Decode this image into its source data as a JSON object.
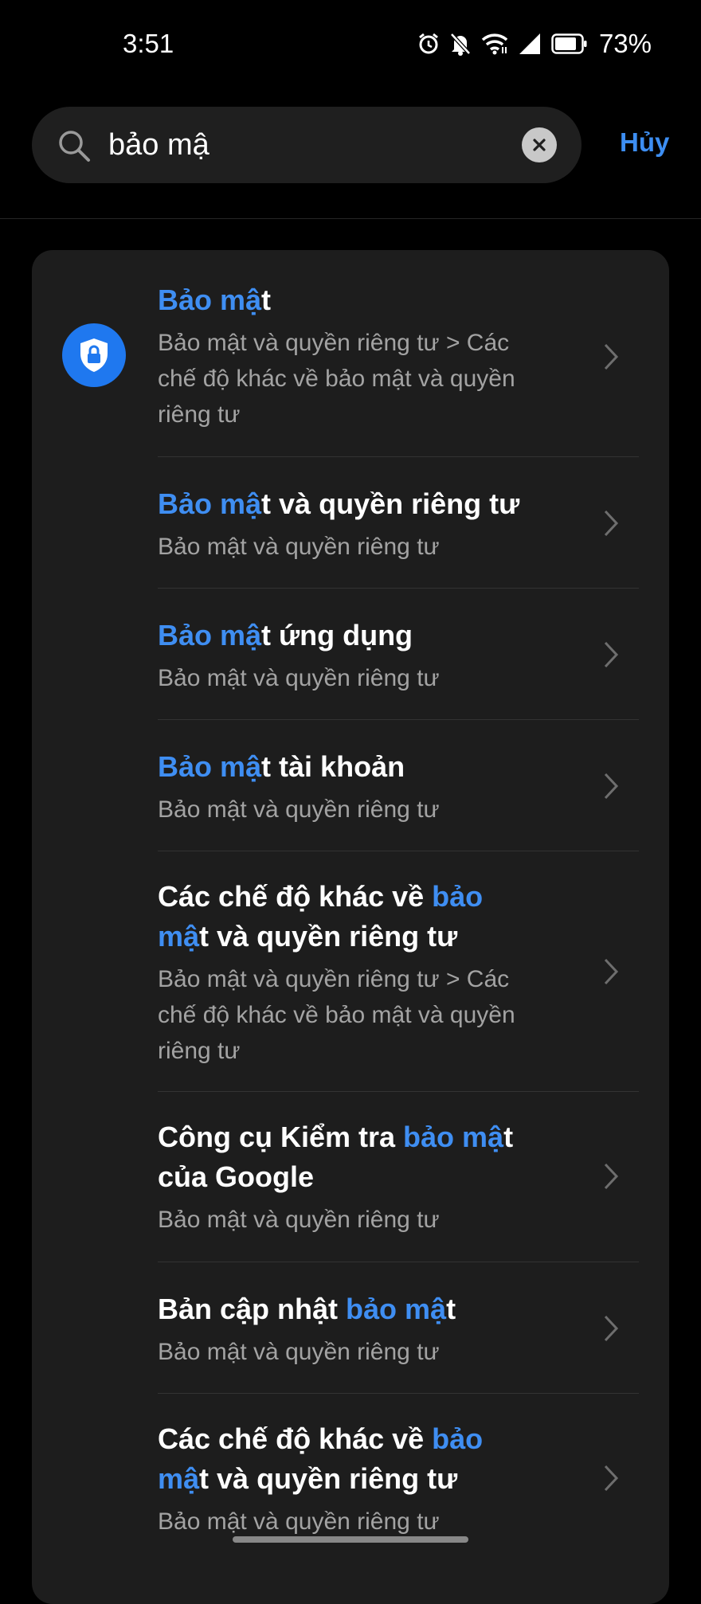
{
  "status_bar": {
    "time": "3:51",
    "battery_percent": "73%",
    "icons": [
      "alarm-icon",
      "mute-icon",
      "wifi-icon",
      "signal-icon",
      "battery-icon"
    ]
  },
  "search": {
    "value": "bảo mậ",
    "placeholder": "",
    "cancel_label": "Hủy"
  },
  "colors": {
    "highlight": "#3f8ef2",
    "card_bg": "#1d1d1d",
    "shield_bg": "#1f78ef"
  },
  "results": [
    {
      "title_pre": "",
      "title_hl": "Bảo mậ",
      "title_post": "t",
      "path": "Bảo mật và quyền riêng tư > Các chế độ khác về bảo mật và quyền riêng tư",
      "icon": "shield-lock-icon"
    },
    {
      "title_pre": "",
      "title_hl": "Bảo mậ",
      "title_post": "t và quyền riêng tư",
      "path": "Bảo mật và quyền riêng tư"
    },
    {
      "title_pre": "",
      "title_hl": "Bảo mậ",
      "title_post": "t ứng dụng",
      "path": "Bảo mật và quyền riêng tư"
    },
    {
      "title_pre": "",
      "title_hl": "Bảo mậ",
      "title_post": "t tài khoản",
      "path": "Bảo mật và quyền riêng tư"
    },
    {
      "title_pre": "Các chế độ khác về ",
      "title_hl": "bảo mậ",
      "title_post": "t và quyền riêng tư",
      "path": "Bảo mật và quyền riêng tư > Các chế độ khác về bảo mật và quyền riêng tư"
    },
    {
      "title_pre": "Công cụ Kiểm tra ",
      "title_hl": "bảo mậ",
      "title_post": "t của Google",
      "path": "Bảo mật và quyền riêng tư"
    },
    {
      "title_pre": "Bản cập nhật ",
      "title_hl": "bảo mậ",
      "title_post": "t",
      "path": "Bảo mật và quyền riêng tư"
    },
    {
      "title_pre": "Các chế độ khác về ",
      "title_hl": "bảo mậ",
      "title_post": "t và quyền riêng tư",
      "path": "Bảo mật và quyền riêng tư"
    }
  ]
}
